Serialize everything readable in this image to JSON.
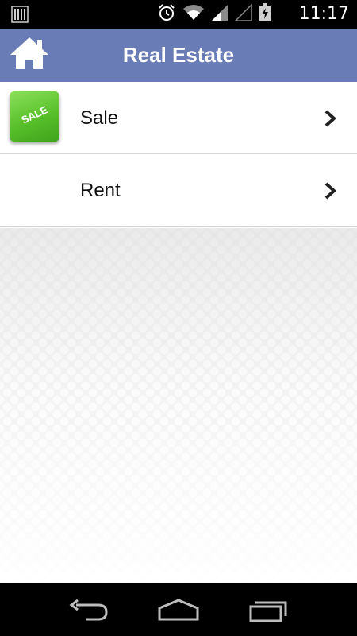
{
  "status_bar": {
    "time": "11:17",
    "icons": [
      "barcode-icon",
      "alarm-icon",
      "wifi-icon",
      "signal-icon",
      "signal-empty-icon",
      "battery-charging-icon"
    ]
  },
  "header": {
    "title": "Real Estate",
    "home_icon": "home-icon",
    "color": "#6a7cb6"
  },
  "list": {
    "items": [
      {
        "label": "Sale",
        "icon": "sale-badge-icon",
        "badge_text": "SALE"
      },
      {
        "label": "Rent"
      }
    ]
  },
  "nav_bar": {
    "buttons": [
      "back-icon",
      "home-icon",
      "recent-apps-icon"
    ]
  }
}
